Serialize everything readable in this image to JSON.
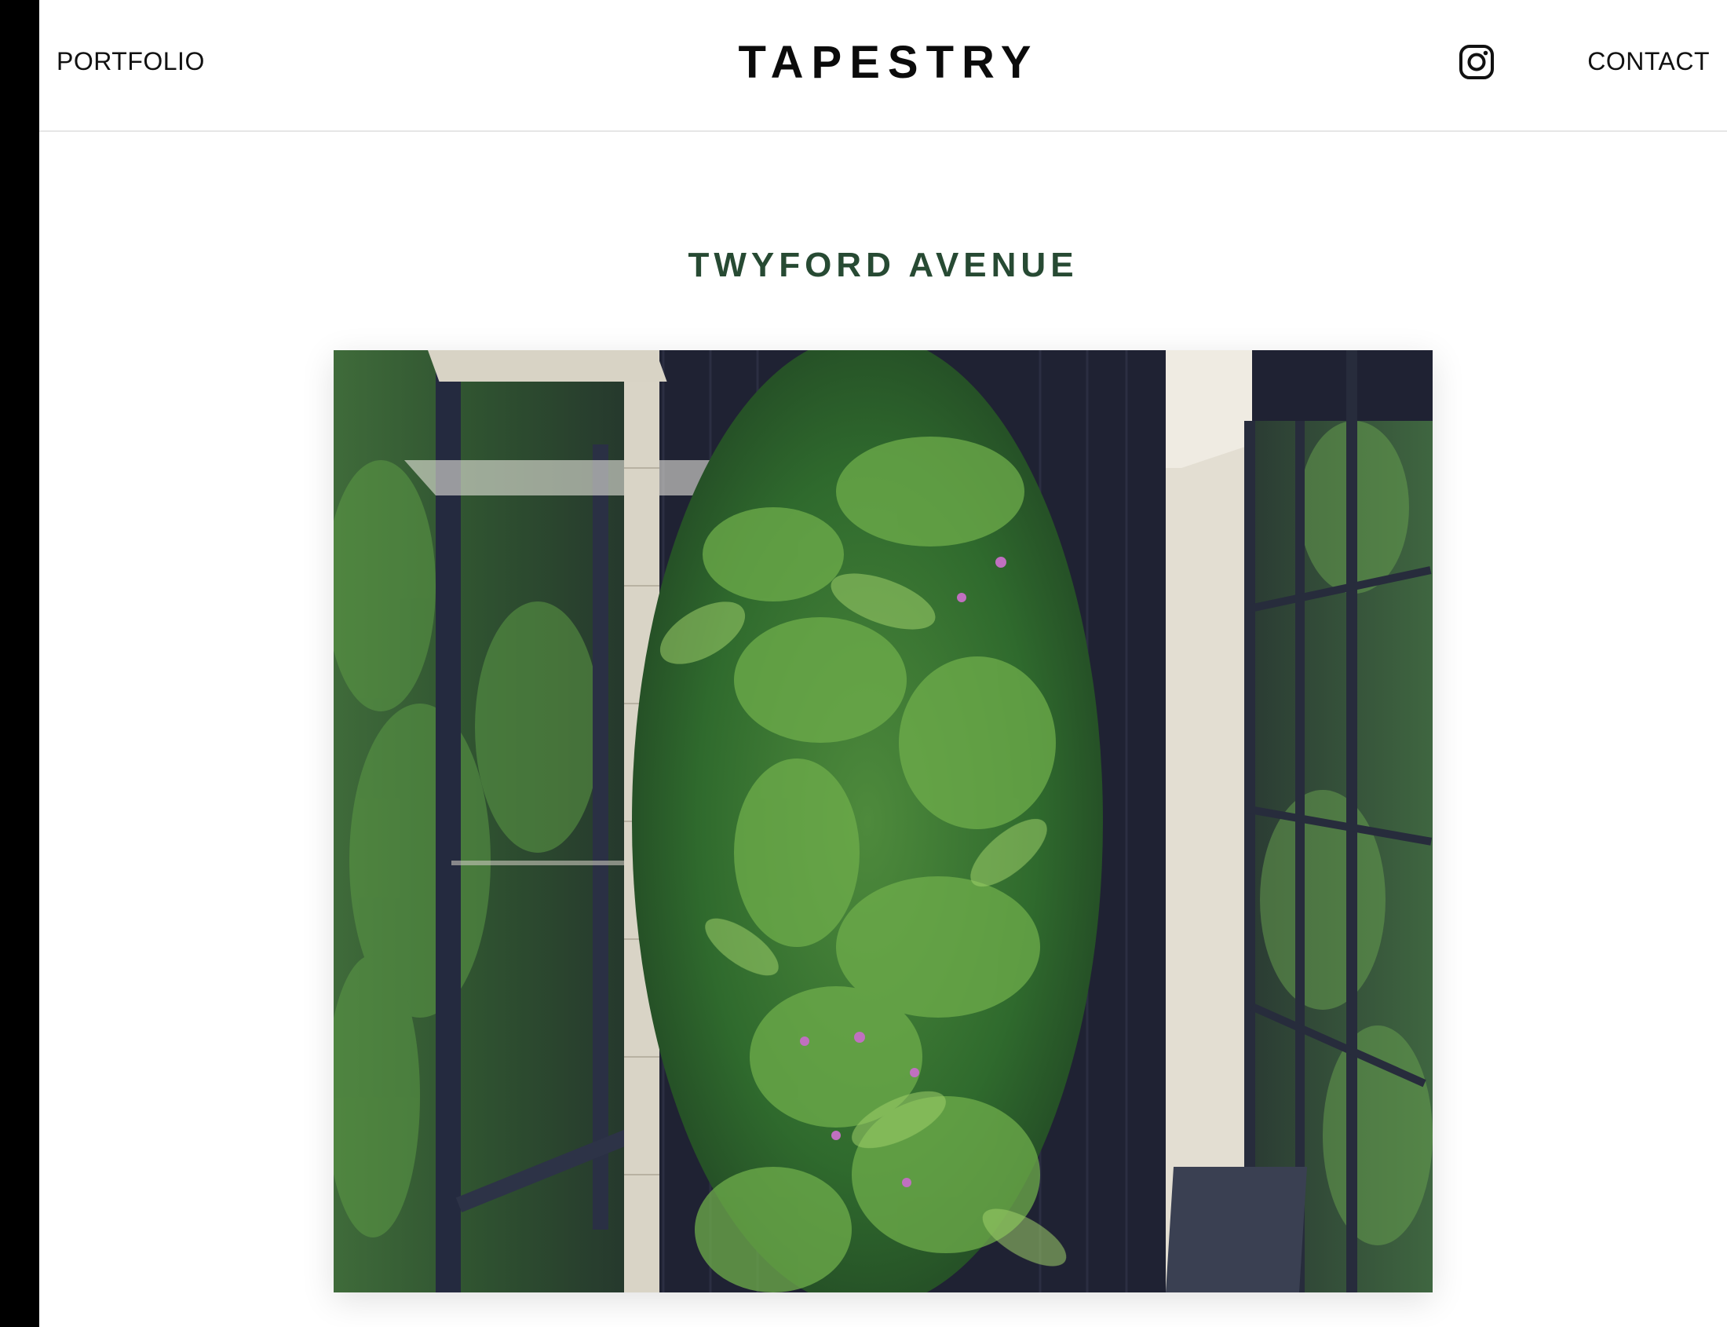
{
  "header": {
    "nav_left": "PORTFOLIO",
    "brand": "TAPESTRY",
    "social_icon": "instagram-icon",
    "nav_right": "CONTACT"
  },
  "project": {
    "title": "TWYFORD AVENUE",
    "image": "living-wall-photo"
  },
  "colors": {
    "title": "#274a33",
    "text": "#111111",
    "background": "#ffffff",
    "frame": "#000000"
  }
}
